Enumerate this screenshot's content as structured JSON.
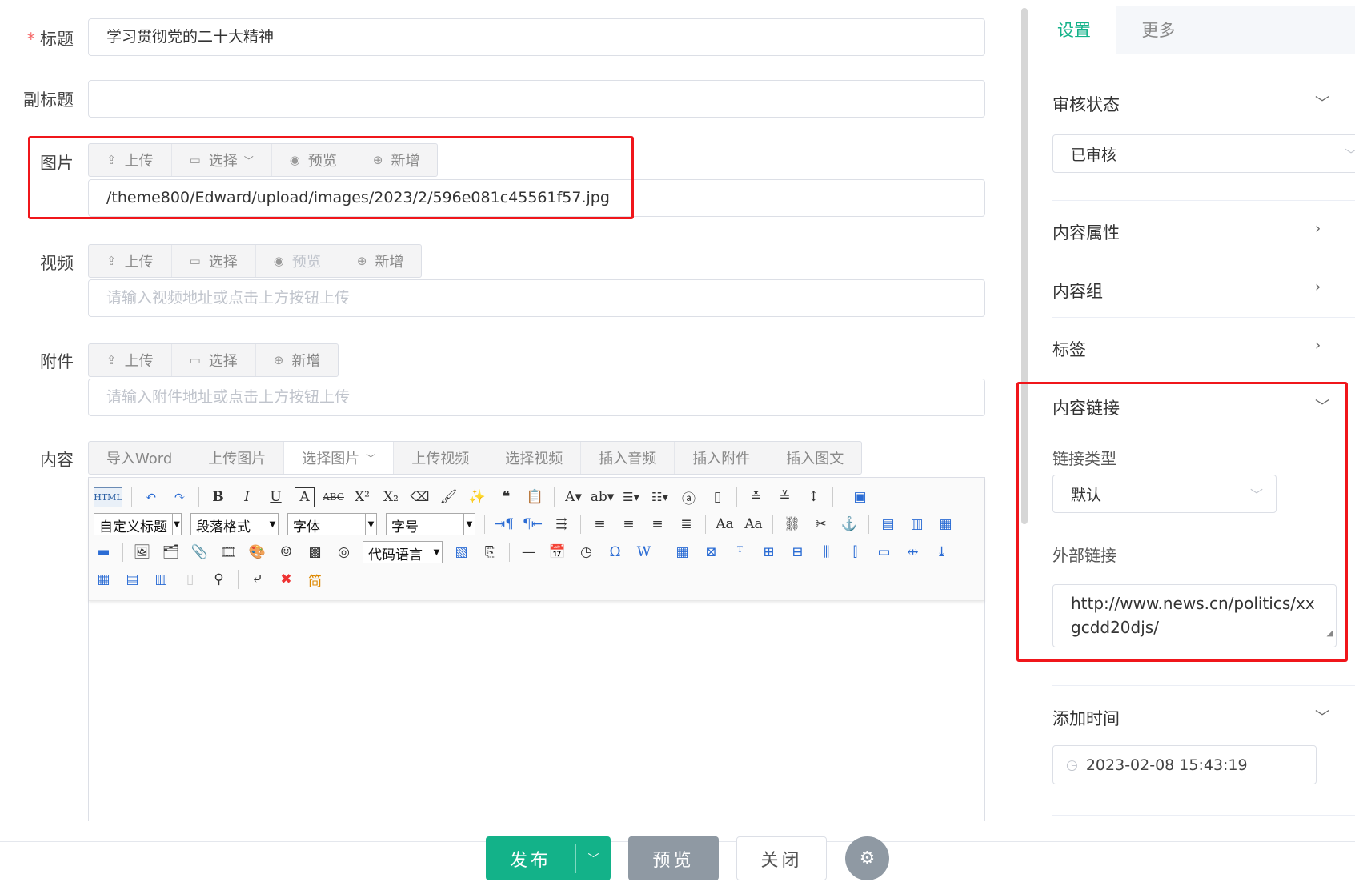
{
  "form": {
    "title": {
      "label": "标题",
      "required_mark": "*",
      "value": "学习贯彻党的二十大精神"
    },
    "subtitle": {
      "label": "副标题",
      "value": ""
    },
    "image": {
      "label": "图片",
      "buttons": {
        "upload": "上传",
        "select": "选择",
        "preview": "预览",
        "add": "新增"
      },
      "value": "/theme800/Edward/upload/images/2023/2/596e081c45561f57.jpg"
    },
    "video": {
      "label": "视频",
      "buttons": {
        "upload": "上传",
        "select": "选择",
        "preview": "预览",
        "add": "新增"
      },
      "placeholder": "请输入视频地址或点击上方按钮上传"
    },
    "attachment": {
      "label": "附件",
      "buttons": {
        "upload": "上传",
        "select": "选择",
        "add": "新增"
      },
      "placeholder": "请输入附件地址或点击上方按钮上传"
    },
    "content": {
      "label": "内容",
      "buttons": {
        "import_word": "导入Word",
        "upload_image": "上传图片",
        "select_image": "选择图片",
        "upload_video": "上传视频",
        "select_video": "选择视频",
        "insert_audio": "插入音频",
        "insert_attachment": "插入附件",
        "insert_article": "插入图文"
      },
      "toolbar": {
        "custom_heading": "自定义标题",
        "paragraph_format": "段落格式",
        "font_family": "字体",
        "font_size": "字号",
        "code_language": "代码语言",
        "html_label": "HTML"
      }
    }
  },
  "sidebar": {
    "tabs": {
      "settings": "设置",
      "more": "更多"
    },
    "review_status": {
      "title": "审核状态",
      "value": "已审核"
    },
    "content_attributes": {
      "title": "内容属性"
    },
    "content_group": {
      "title": "内容组"
    },
    "tags": {
      "title": "标签"
    },
    "content_link": {
      "title": "内容链接",
      "link_type_label": "链接类型",
      "link_type_value": "默认",
      "external_link_label": "外部链接",
      "external_link_value": "http://www.news.cn/politics/xxgcdd20djs/"
    },
    "add_time": {
      "title": "添加时间",
      "value": "2023-02-08 15:43:19"
    }
  },
  "footer": {
    "publish": "发布",
    "preview": "预览",
    "close": "关闭"
  },
  "colors": {
    "accent": "#13b289",
    "highlight_box": "#f0161b",
    "muted_button": "#8f99a3"
  }
}
